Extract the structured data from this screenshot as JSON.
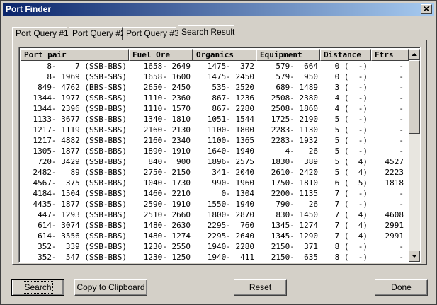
{
  "window": {
    "title": "Port Finder"
  },
  "tabs": [
    "Port Query #1",
    "Port Query #2",
    "Port Query #3",
    "Search Result"
  ],
  "columns": [
    "Port pair",
    "Fuel Ore",
    "Organics",
    "Equipment",
    "Distance",
    "Ftrs"
  ],
  "rows": [
    [
      "   8-    7 (SSB-BBS)",
      "1658- 2649",
      "1475-  372",
      " 579-  664",
      "0 (  -)",
      "-"
    ],
    [
      "   8- 1969 (SSB-SBS)",
      "1658- 1600",
      "1475- 2450",
      " 579-  950",
      "0 (  -)",
      "-"
    ],
    [
      " 849- 4762 (BBS-SBS)",
      "2650- 2450",
      " 535- 2520",
      " 689- 1489",
      "3 (  -)",
      "-"
    ],
    [
      "1344- 1977 (SSB-SBS)",
      "1110- 2360",
      " 867- 1236",
      "2508- 2380",
      "4 (  -)",
      "-"
    ],
    [
      "1344- 2396 (SSB-BBS)",
      "1110- 1570",
      " 867- 2280",
      "2508- 1860",
      "4 (  -)",
      "-"
    ],
    [
      "1133- 3677 (SSB-BBS)",
      "1340- 1810",
      "1051- 1544",
      "1725- 2190",
      "5 (  -)",
      "-"
    ],
    [
      "1217- 1119 (SSB-SBS)",
      "2160- 2130",
      "1100- 1800",
      "2283- 1130",
      "5 (  -)",
      "-"
    ],
    [
      "1217- 4882 (SSB-BBS)",
      "2160- 2340",
      "1100- 1365",
      "2283- 1932",
      "5 (  -)",
      "-"
    ],
    [
      "1305- 1877 (SSB-BBS)",
      "1890- 1910",
      "1640- 1940",
      "   4-   26",
      "5 (  -)",
      "-"
    ],
    [
      " 720- 3429 (SSB-BBS)",
      " 840-  900",
      "1896- 2575",
      "1830-  389",
      "5 (  4)",
      "4527"
    ],
    [
      "2482-   89 (SSB-BBS)",
      "2750- 2150",
      " 341- 2040",
      "2610- 2420",
      "5 (  4)",
      "2223"
    ],
    [
      "4567-  375 (SSB-BBS)",
      "1040- 1730",
      " 990- 1960",
      "1750- 1810",
      "6 (  5)",
      "1818"
    ],
    [
      "4184- 1504 (SSB-BBS)",
      "1460- 2210",
      "   0- 1304",
      "2200- 1135",
      "7 (  -)",
      "-"
    ],
    [
      "4435- 1877 (SSB-BBS)",
      "2590- 1910",
      "1550- 1940",
      " 790-   26",
      "7 (  -)",
      "-"
    ],
    [
      " 447- 1293 (SSB-BBS)",
      "2510- 2660",
      "1800- 2870",
      " 830- 1450",
      "7 (  4)",
      "4608"
    ],
    [
      " 614- 3074 (SSB-BBS)",
      "1480- 2630",
      "2295-  760",
      "1345- 1274",
      "7 (  4)",
      "2991"
    ],
    [
      " 614- 3556 (SSB-BBS)",
      "1480- 1274",
      "2295- 2640",
      "1345- 1290",
      "7 (  4)",
      "2991"
    ],
    [
      " 352-  339 (SSB-BBS)",
      "1230- 2550",
      "1940- 2280",
      "2150-  371",
      "8 (  -)",
      "-"
    ],
    [
      " 352-  547 (SSB-BBS)",
      "1230- 1250",
      "1940-  411",
      "2150-  635",
      "8 (  -)",
      "-"
    ]
  ],
  "buttons": {
    "search": "Search",
    "copy": "Copy to Clipboard",
    "reset": "Reset",
    "done": "Done"
  }
}
